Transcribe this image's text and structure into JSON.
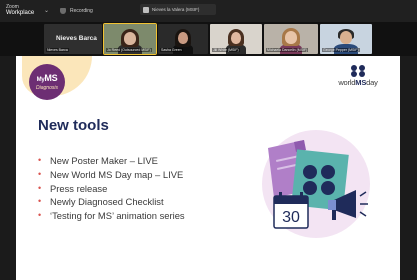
{
  "topbar": {
    "app_name_small": "Zoom",
    "app_name": "Workplace",
    "recording_label": "Recording",
    "meeting_title": "Nieves la Valera (MSIF)"
  },
  "participants": [
    {
      "name": "Nieves Barca",
      "label": "Nieves Barca",
      "active": false,
      "video": false
    },
    {
      "name": "Jo Reed (MSIF)",
      "label": "Jo Reed (Outsourced MSIF)",
      "active": true,
      "video": true
    },
    {
      "name": "Sasha Green",
      "label": "Sasha Green",
      "active": false,
      "video": true
    },
    {
      "name": "Jill White (MSIF)",
      "label": "Jill White (MSIF)",
      "active": false,
      "video": true
    },
    {
      "name": "Michaela Dancelin",
      "label": "Michaela Dancelin (MSIF)",
      "active": false,
      "video": true
    },
    {
      "name": "George Pepper",
      "label": "George Pepper (MSIF)",
      "active": false,
      "video": true
    }
  ],
  "slide": {
    "logo_line1": "My",
    "logo_line1b": "MS",
    "logo_line2": "Diagnosis",
    "brand_prefix": "world",
    "brand_bold": "MS",
    "brand_suffix": "day",
    "title": "New tools",
    "bullets": [
      "New Poster Maker – LIVE",
      "New World MS Day map – LIVE",
      "Press release",
      "Newly Diagnosed Checklist",
      "‘Testing for MS’ animation series"
    ],
    "calendar_day": "30"
  },
  "colors": {
    "title": "#1f2b5a",
    "bullet": "#d9534f",
    "logo": "#6d2e73",
    "blob": "#fbe6ba",
    "illustration_circle": "#f0e0f0",
    "illustration_teal": "#5ab3ad"
  }
}
